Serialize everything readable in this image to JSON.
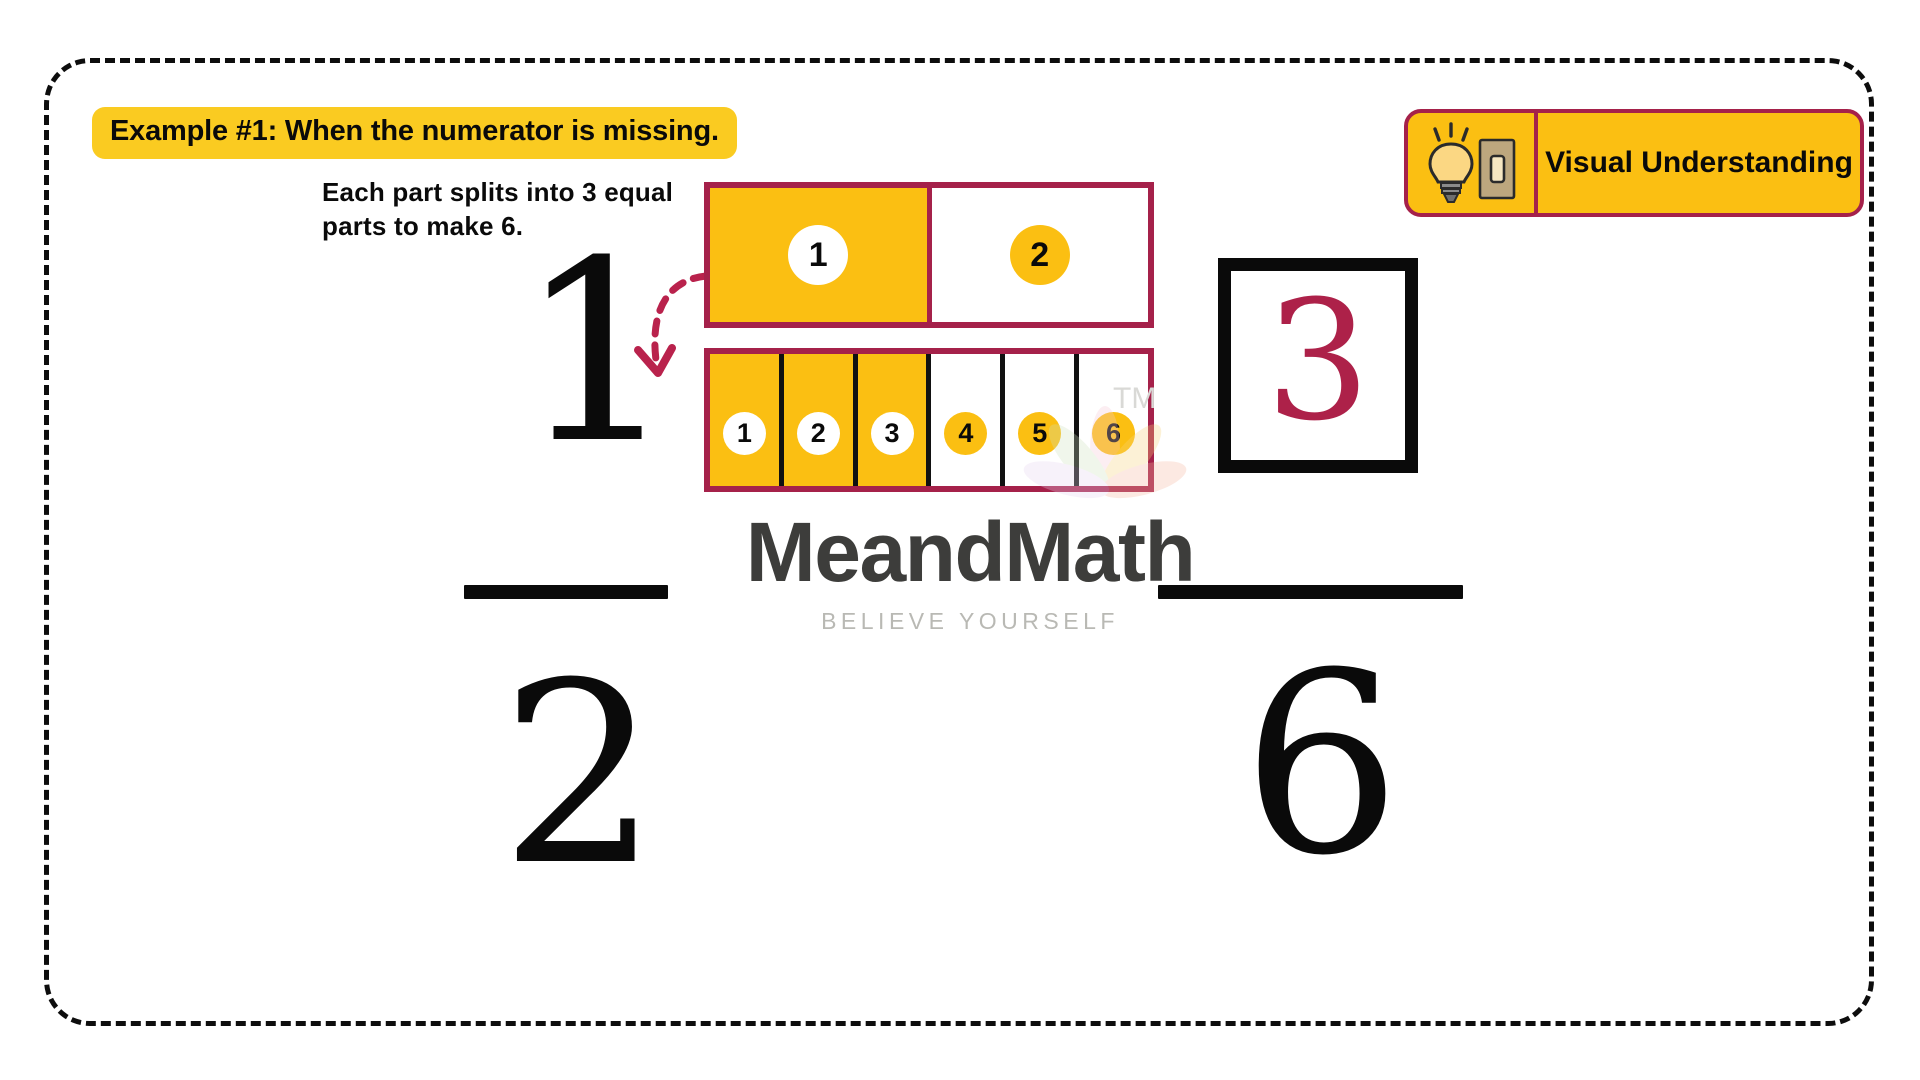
{
  "card": {
    "title_pill": "Example #1: When the numerator is missing.",
    "instruction": "Each part splits into 3 equal parts to make 6."
  },
  "badge": {
    "label": "Visual Understanding",
    "icon": "lightbulb-switch-icon",
    "fill_color": "#fbbf12",
    "border_color": "#a5214a"
  },
  "fraction_left": {
    "numerator": "1",
    "denominator": "2"
  },
  "fraction_right": {
    "numerator_box": "3",
    "denominator": "6",
    "box_border_color": "#0a0a0a",
    "numerator_color": "#ad2149"
  },
  "bar_model_top": {
    "parts": 2,
    "cells": [
      {
        "label": "1",
        "shaded": true
      },
      {
        "label": "2",
        "shaded": false
      }
    ]
  },
  "bar_model_bottom": {
    "parts": 6,
    "cells": [
      {
        "label": "1",
        "shaded": true
      },
      {
        "label": "2",
        "shaded": true
      },
      {
        "label": "3",
        "shaded": true
      },
      {
        "label": "4",
        "shaded": false
      },
      {
        "label": "5",
        "shaded": false
      },
      {
        "label": "6",
        "shaded": false
      }
    ]
  },
  "arrow": {
    "name": "curved-dashed-arrow",
    "color": "#b9224c"
  },
  "watermark": {
    "brand": "MeandMath",
    "tagline": "BELIEVE YOURSELF",
    "trademark": "TM"
  },
  "palette": {
    "yellow": "#fbbf12",
    "crimson": "#a5214a",
    "black": "#0a0a0a"
  }
}
